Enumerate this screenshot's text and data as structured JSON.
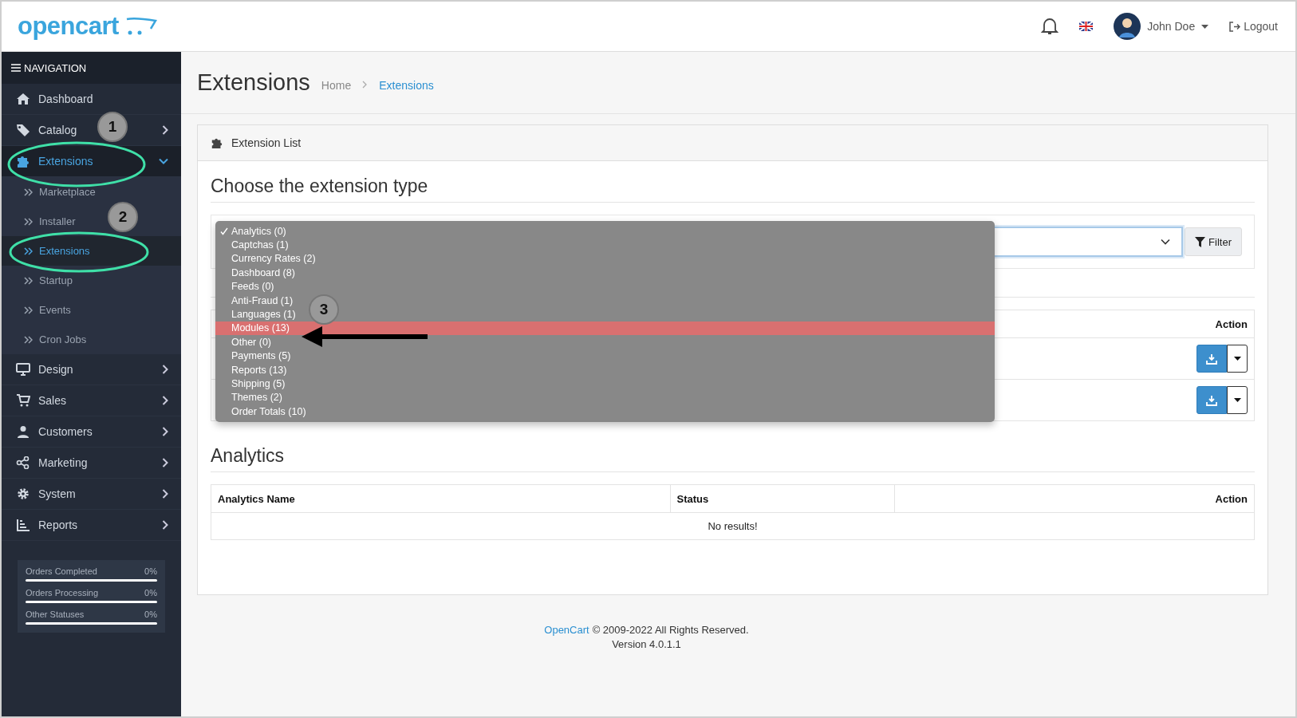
{
  "header": {
    "logo": "opencart",
    "user": "John Doe",
    "logout": "Logout"
  },
  "sidebar": {
    "title": "NAVIGATION",
    "items": [
      {
        "label": "Dashboard",
        "selected": false
      },
      {
        "label": "Catalog",
        "selected": false,
        "expanded": false
      },
      {
        "label": "Extensions",
        "selected": true,
        "expanded": true,
        "children": [
          {
            "label": "Marketplace",
            "selected": false
          },
          {
            "label": "Installer",
            "selected": false
          },
          {
            "label": "Extensions",
            "selected": true
          },
          {
            "label": "Startup",
            "selected": false
          },
          {
            "label": "Events",
            "selected": false
          },
          {
            "label": "Cron Jobs",
            "selected": false
          }
        ]
      },
      {
        "label": "Design",
        "selected": false,
        "expanded": false
      },
      {
        "label": "Sales",
        "selected": false,
        "expanded": false
      },
      {
        "label": "Customers",
        "selected": false,
        "expanded": false
      },
      {
        "label": "Marketing",
        "selected": false,
        "expanded": false
      },
      {
        "label": "System",
        "selected": false,
        "expanded": false
      },
      {
        "label": "Reports",
        "selected": false,
        "expanded": false
      }
    ],
    "stats": [
      {
        "label": "Orders Completed",
        "reading": "0%",
        "level": 0
      },
      {
        "label": "Orders Processing",
        "reading": "0%",
        "level": 0
      },
      {
        "label": "Other Statuses",
        "reading": "0%",
        "level": 0
      }
    ]
  },
  "page": {
    "title": "Extensions",
    "breadcrumb": [
      {
        "label": "Home",
        "selected": false
      },
      {
        "label": "Extensions",
        "selected": true
      }
    ]
  },
  "card": {
    "title": "Extension List",
    "choose_heading": "Choose the extension type",
    "filter_button": "Filter",
    "dropdown": [
      {
        "label": "Analytics (0)",
        "checked": true,
        "selected": false
      },
      {
        "label": "Captchas (1)",
        "checked": false,
        "selected": false
      },
      {
        "label": "Currency Rates (2)",
        "checked": false,
        "selected": false
      },
      {
        "label": "Dashboard (8)",
        "checked": false,
        "selected": false
      },
      {
        "label": "Feeds (0)",
        "checked": false,
        "selected": false
      },
      {
        "label": "Anti-Fraud (1)",
        "checked": false,
        "selected": false
      },
      {
        "label": "Languages (1)",
        "checked": false,
        "selected": false
      },
      {
        "label": "Modules (13)",
        "checked": false,
        "selected": true
      },
      {
        "label": "Other (0)",
        "checked": false,
        "selected": false
      },
      {
        "label": "Payments (5)",
        "checked": false,
        "selected": false
      },
      {
        "label": "Reports (13)",
        "checked": false,
        "selected": false
      },
      {
        "label": "Shipping (5)",
        "checked": false,
        "selected": false
      },
      {
        "label": "Themes (2)",
        "checked": false,
        "selected": false
      },
      {
        "label": "Order Totals (10)",
        "checked": false,
        "selected": false
      }
    ],
    "top_table": {
      "columns": [
        "Action"
      ],
      "rows": [
        {
          "kind": "install"
        },
        {
          "kind": "install"
        }
      ]
    },
    "analytics_heading": "Analytics",
    "analytics_table": {
      "columns": [
        "Analytics Name",
        "Status",
        "Action"
      ],
      "empty": "No results!"
    }
  },
  "footer": {
    "link": "OpenCart",
    "text": "© 2009-2022 All Rights Reserved.",
    "version": "Version 4.0.1.1"
  },
  "annotations": [
    "1",
    "2",
    "3"
  ]
}
